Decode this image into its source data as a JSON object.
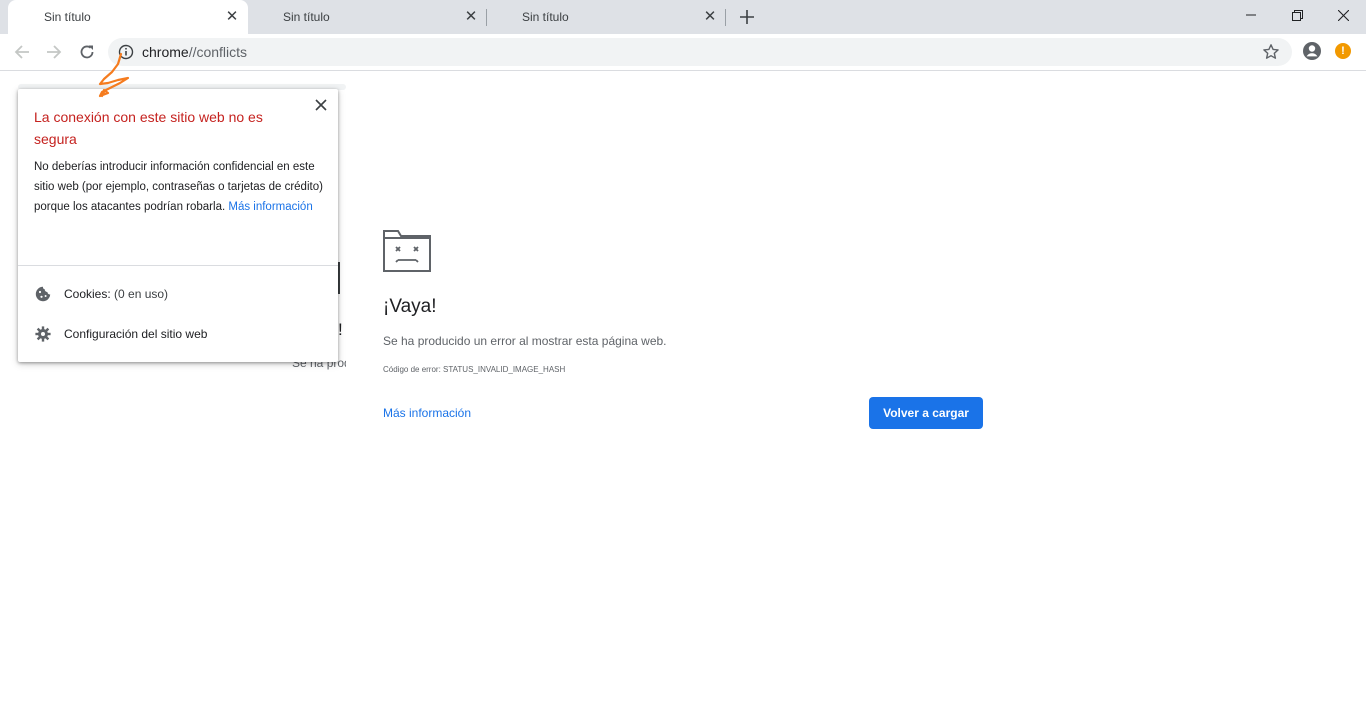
{
  "browser": {
    "tabs": [
      {
        "title": "Sin título",
        "active": true
      },
      {
        "title": "Sin título",
        "active": false
      },
      {
        "title": "Sin título",
        "active": false
      }
    ],
    "omnibox": {
      "scheme": "chrome",
      "sep": "//",
      "host": "conflicts"
    },
    "alert_badge": "!"
  },
  "error_page": {
    "heading": "¡Vaya!",
    "description": "Se ha producido un error al mostrar esta página web.",
    "error_code": "Código de error: STATUS_INVALID_IMAGE_HASH",
    "more_info": "Más información",
    "reload": "Volver a cargar"
  },
  "ghost": {
    "exclamation": "!",
    "text": "Se ha producido un error al mostrar esta página web."
  },
  "site_info_popup": {
    "title": "La conexión con este sitio web no es segura",
    "body": "No deberías introducir información confidencial en este sitio web (por ejemplo, contraseñas o tarjetas de crédito) porque los atacantes podrían robarla. ",
    "link": "Más información",
    "cookies_label": "Cookies:",
    "cookies_count": " (0 en uso)",
    "site_settings": "Configuración del sitio web"
  },
  "colors": {
    "accent": "#1a73e8",
    "warning_title": "#c5221f",
    "alert_badge": "#f29900",
    "annotation": "#f57c1f"
  }
}
